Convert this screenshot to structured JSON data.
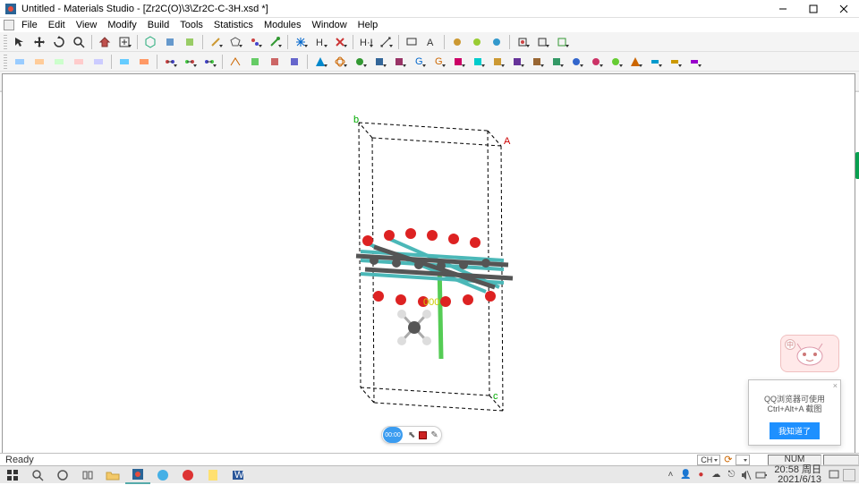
{
  "window": {
    "title": "Untitled - Materials Studio - [Zr2C(O)\\3\\Zr2C-C-3H.xsd *]"
  },
  "menu": {
    "items": [
      "File",
      "Edit",
      "View",
      "Modify",
      "Build",
      "Tools",
      "Statistics",
      "Modules",
      "Window",
      "Help"
    ]
  },
  "status": {
    "ready": "Ready",
    "lang": "CH",
    "num": "NUM"
  },
  "recorder": {
    "time": "00:00"
  },
  "notif": {
    "text": "QQ浏览器可使用 Ctrl+Alt+A 截图",
    "button": "我知道了"
  },
  "tray": {
    "time": "20:58 周日",
    "date": "2021/6/13"
  },
  "cell": {
    "axis_a": "A",
    "axis_c": "c",
    "origin": "000"
  },
  "iconTips": {
    "arrow": "select-tool",
    "hand": "pan-tool",
    "rotate": "rotate-tool",
    "zoom": "zoom-tool",
    "home": "home",
    "layers": "layers",
    "clip": "clipboard",
    "sketch": "sketch",
    "model": "model",
    "atom": "atom",
    "bond": "bond",
    "calc": "calculate"
  }
}
